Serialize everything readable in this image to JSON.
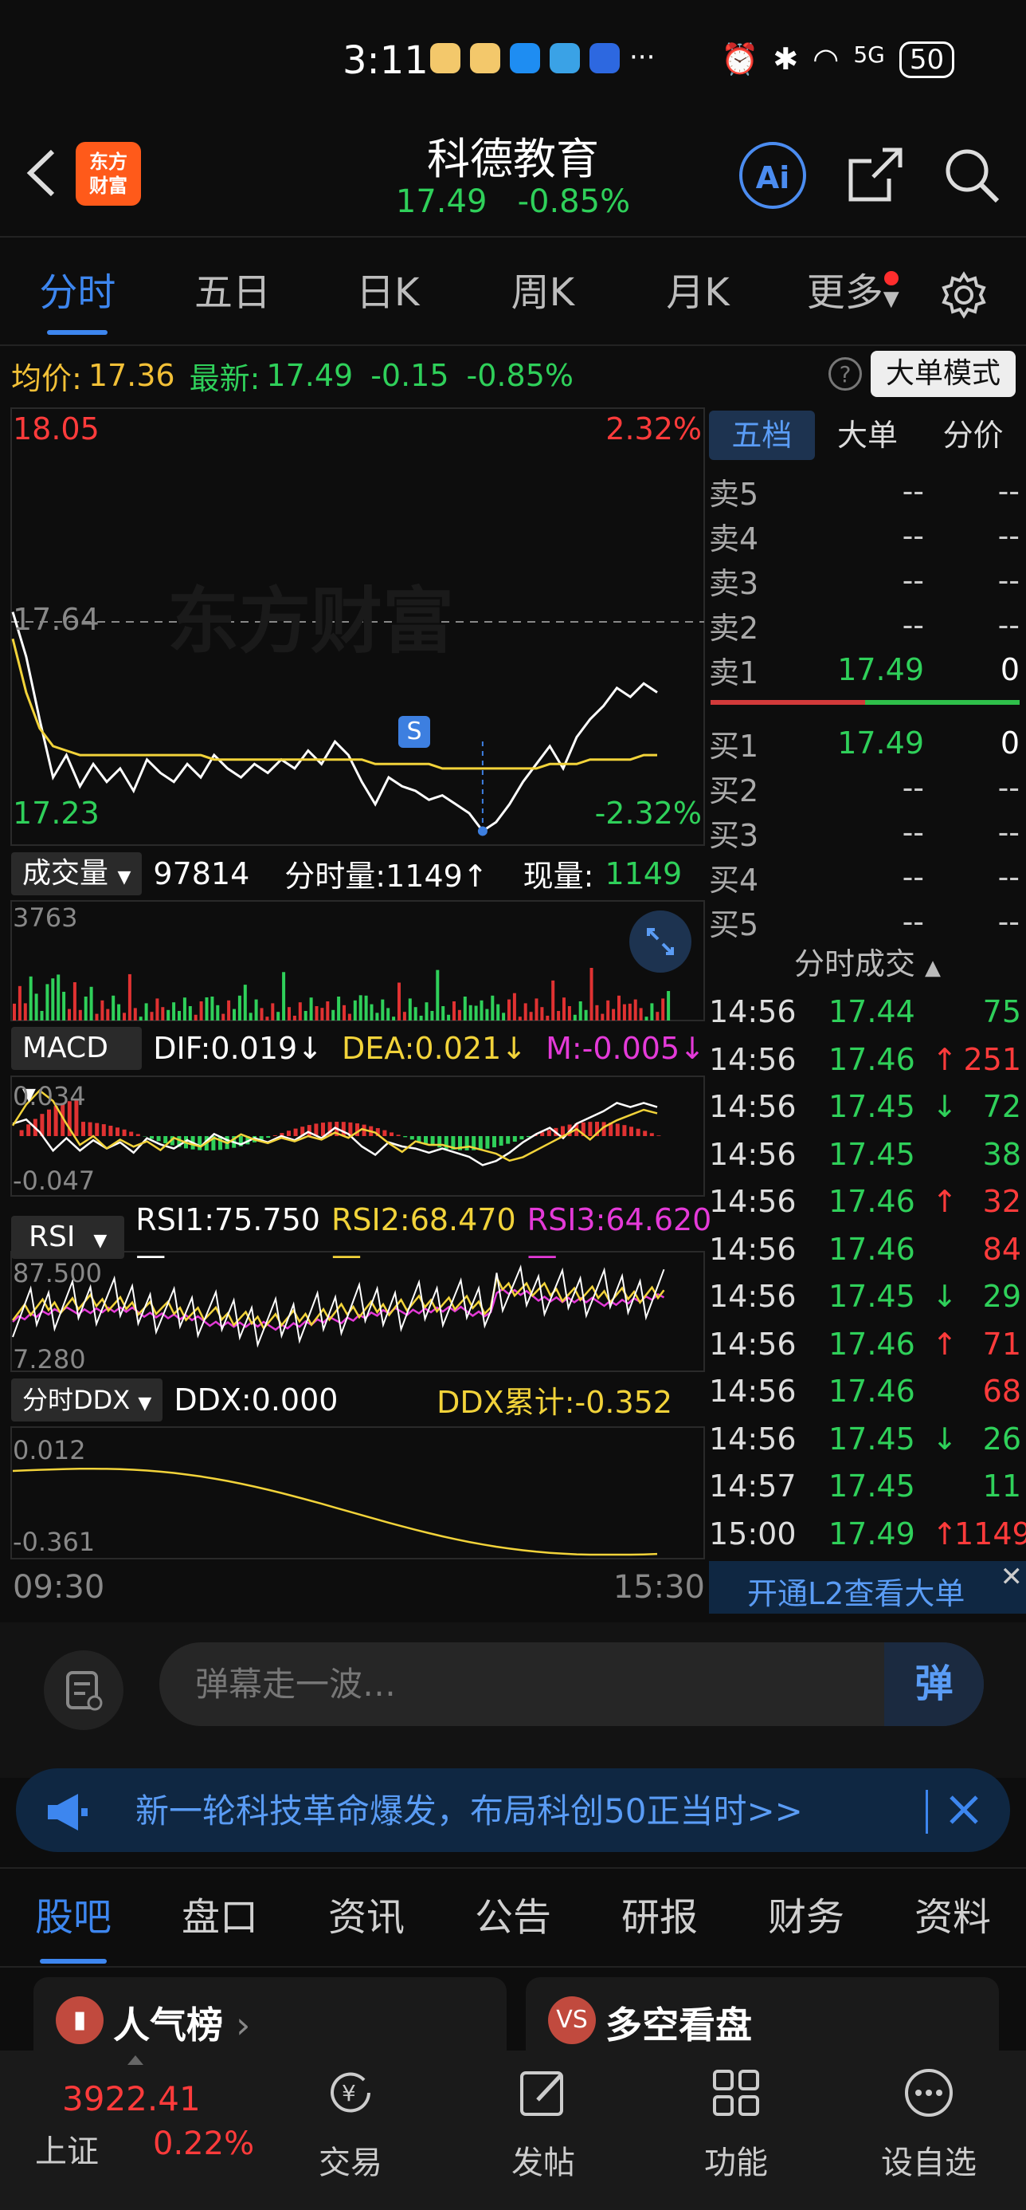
{
  "status": {
    "time": "3:11",
    "battery": "50",
    "signal": "5G"
  },
  "header": {
    "title": "科德教育",
    "price": "17.49",
    "change_pct": "-0.85%",
    "logo_line1": "东方",
    "logo_line2": "财富",
    "ai_label": "Ai"
  },
  "tabs": [
    {
      "label": "分时"
    },
    {
      "label": "五日"
    },
    {
      "label": "日K"
    },
    {
      "label": "周K"
    },
    {
      "label": "月K"
    },
    {
      "label": "更多"
    }
  ],
  "infobar": {
    "avg_label": "均价:",
    "avg_value": "17.36",
    "latest_label": "最新:",
    "latest_value": "17.49",
    "change": "-0.15",
    "change_pct": "-0.85%",
    "big_order_btn": "大单模式"
  },
  "intraday": {
    "high": "18.05",
    "high_pct": "2.32%",
    "mid": "17.64",
    "low": "17.23",
    "low_pct": "-2.32%",
    "marker": "S",
    "time_start": "09:30",
    "time_end": "15:30",
    "price_series": [
      17.68,
      17.58,
      17.44,
      17.31,
      17.36,
      17.29,
      17.34,
      17.3,
      17.33,
      17.28,
      17.35,
      17.32,
      17.3,
      17.34,
      17.31,
      17.36,
      17.33,
      17.31,
      17.34,
      17.32,
      17.35,
      17.33,
      17.37,
      17.34,
      17.39,
      17.36,
      17.3,
      17.25,
      17.31,
      17.29,
      17.28,
      17.26,
      17.27,
      17.25,
      17.23,
      17.19,
      17.21,
      17.25,
      17.3,
      17.34,
      17.38,
      17.33,
      17.4,
      17.44,
      17.47,
      17.51,
      17.49,
      17.52,
      17.5
    ],
    "avg_series": [
      17.62,
      17.5,
      17.42,
      17.38,
      17.37,
      17.36,
      17.36,
      17.36,
      17.36,
      17.36,
      17.36,
      17.36,
      17.36,
      17.36,
      17.36,
      17.35,
      17.35,
      17.35,
      17.35,
      17.35,
      17.35,
      17.35,
      17.35,
      17.35,
      17.35,
      17.35,
      17.35,
      17.34,
      17.34,
      17.34,
      17.34,
      17.34,
      17.33,
      17.33,
      17.33,
      17.33,
      17.33,
      17.33,
      17.33,
      17.33,
      17.34,
      17.34,
      17.34,
      17.35,
      17.35,
      17.35,
      17.35,
      17.36,
      17.36
    ]
  },
  "volume": {
    "selector": "成交量",
    "total": "97814",
    "tick_label": "分时量:1149",
    "tick_arrow": "↑",
    "now_label": "现量:",
    "now_value": "1149",
    "max": "3763"
  },
  "macd": {
    "selector": "MACD",
    "dif": "DIF:0.019",
    "dif_arrow": "↓",
    "dea": "DEA:0.021",
    "dea_arrow": "↓",
    "m": "M:-0.005",
    "m_arrow": "↓",
    "top": "0.034",
    "bottom": "-0.047"
  },
  "rsi": {
    "selector": "RSI",
    "rsi1": "RSI1:75.750",
    "rsi2": "RSI2:68.470",
    "rsi3": "RSI3:64.620",
    "dash": "—",
    "top": "87.500",
    "bottom": "7.280"
  },
  "ddx": {
    "selector": "分时DDX",
    "ddx": "DDX:0.000",
    "total": "DDX累计:-0.352",
    "top": "0.012",
    "bottom": "-0.361"
  },
  "orderbook": {
    "tabs": [
      "五档",
      "大单",
      "分价"
    ],
    "asks": [
      {
        "label": "卖5",
        "price": "--",
        "vol": "--"
      },
      {
        "label": "卖4",
        "price": "--",
        "vol": "--"
      },
      {
        "label": "卖3",
        "price": "--",
        "vol": "--"
      },
      {
        "label": "卖2",
        "price": "--",
        "vol": "--"
      },
      {
        "label": "卖1",
        "price": "17.49",
        "vol": "0"
      }
    ],
    "bids": [
      {
        "label": "买1",
        "price": "17.49",
        "vol": "0"
      },
      {
        "label": "买2",
        "price": "--",
        "vol": "--"
      },
      {
        "label": "买3",
        "price": "--",
        "vol": "--"
      },
      {
        "label": "买4",
        "price": "--",
        "vol": "--"
      },
      {
        "label": "买5",
        "price": "--",
        "vol": "--"
      }
    ],
    "ticks_title": "分时成交",
    "ticks": [
      {
        "time": "14:56",
        "price": "17.44",
        "arrow": "",
        "vol": "75",
        "color": "green"
      },
      {
        "time": "14:56",
        "price": "17.46",
        "arrow": "↑",
        "vol": "251",
        "color": "red"
      },
      {
        "time": "14:56",
        "price": "17.45",
        "arrow": "↓",
        "vol": "72",
        "color": "green"
      },
      {
        "time": "14:56",
        "price": "17.45",
        "arrow": "",
        "vol": "38",
        "color": "green"
      },
      {
        "time": "14:56",
        "price": "17.46",
        "arrow": "↑",
        "vol": "32",
        "color": "red"
      },
      {
        "time": "14:56",
        "price": "17.46",
        "arrow": "",
        "vol": "84",
        "color": "red"
      },
      {
        "time": "14:56",
        "price": "17.45",
        "arrow": "↓",
        "vol": "29",
        "color": "green"
      },
      {
        "time": "14:56",
        "price": "17.46",
        "arrow": "↑",
        "vol": "71",
        "color": "red"
      },
      {
        "time": "14:56",
        "price": "17.46",
        "arrow": "",
        "vol": "68",
        "color": "red"
      },
      {
        "time": "14:56",
        "price": "17.45",
        "arrow": "↓",
        "vol": "26",
        "color": "green"
      },
      {
        "time": "14:57",
        "price": "17.45",
        "arrow": "",
        "vol": "11",
        "color": "green"
      },
      {
        "time": "15:00",
        "price": "17.49",
        "arrow": "↑",
        "vol": "1149",
        "color": "red"
      }
    ],
    "l2_link": "开通L2查看大单"
  },
  "comment": {
    "placeholder": "弹幕走一波…",
    "send": "弹"
  },
  "banner": {
    "text": "新一轮科技革命爆发，布局科创50正当时>>"
  },
  "subtabs": [
    {
      "label": "股吧"
    },
    {
      "label": "盘口"
    },
    {
      "label": "资讯"
    },
    {
      "label": "公告"
    },
    {
      "label": "研报"
    },
    {
      "label": "财务"
    },
    {
      "label": "资料"
    }
  ],
  "cards": [
    {
      "title": "人气榜"
    },
    {
      "title": "多空看盘"
    }
  ],
  "bottom_nav": {
    "index_value": "3922.41",
    "index_name": "上证",
    "index_pct": "0.22%",
    "items": [
      {
        "label": "交易"
      },
      {
        "label": "发帖"
      },
      {
        "label": "功能"
      },
      {
        "label": "设自选"
      }
    ]
  }
}
